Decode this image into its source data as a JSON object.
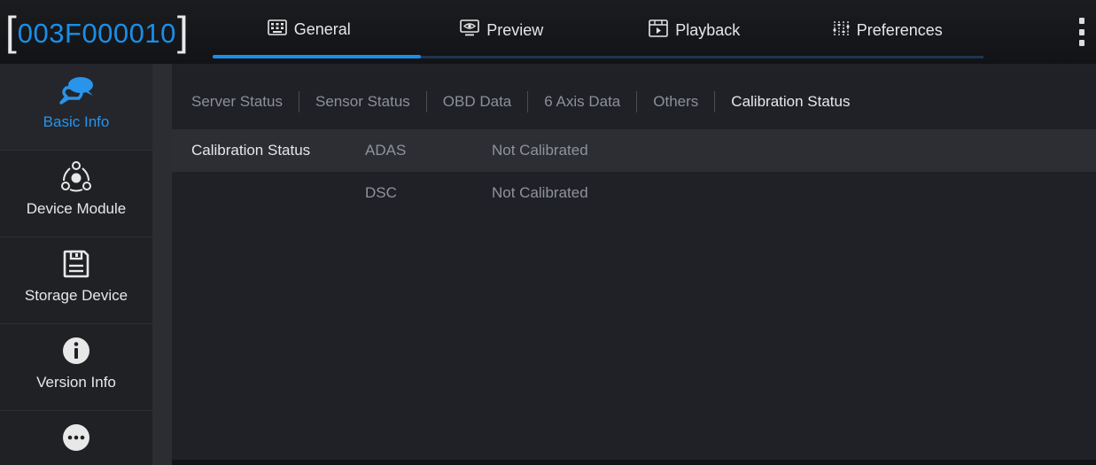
{
  "device": {
    "id": "003F000010",
    "bracket_open": "[",
    "bracket_close": "]"
  },
  "tabs": [
    {
      "label": "General",
      "icon": "keyboard-icon",
      "active": true
    },
    {
      "label": "Preview",
      "icon": "monitor-eye-icon",
      "active": false
    },
    {
      "label": "Playback",
      "icon": "playback-icon",
      "active": false
    },
    {
      "label": "Preferences",
      "icon": "sliders-icon",
      "active": false
    }
  ],
  "sidebar": {
    "items": [
      {
        "label": "Basic Info",
        "icon": "chat-bubbles-icon",
        "active": true
      },
      {
        "label": "Device Module",
        "icon": "module-network-icon",
        "active": false
      },
      {
        "label": "Storage Device",
        "icon": "floppy-disk-icon",
        "active": false
      },
      {
        "label": "Version Info",
        "icon": "info-circle-icon",
        "active": false
      },
      {
        "label": "",
        "icon": "more-dots-icon",
        "active": false
      }
    ]
  },
  "subtabs": [
    {
      "label": "Server Status",
      "active": false
    },
    {
      "label": "Sensor Status",
      "active": false
    },
    {
      "label": "OBD Data",
      "active": false
    },
    {
      "label": "6 Axis Data",
      "active": false
    },
    {
      "label": "Others",
      "active": false
    },
    {
      "label": "Calibration Status",
      "active": true
    }
  ],
  "table": {
    "rows": [
      {
        "name": "Calibration Status",
        "type": "ADAS",
        "value": "Not Calibrated"
      },
      {
        "name": "",
        "type": "DSC",
        "value": "Not Calibrated"
      }
    ]
  },
  "colors": {
    "accent": "#1a8fe8",
    "background": "#0b0c0e",
    "content_bg": "#1f2127",
    "sidebar_bg": "#202124"
  }
}
